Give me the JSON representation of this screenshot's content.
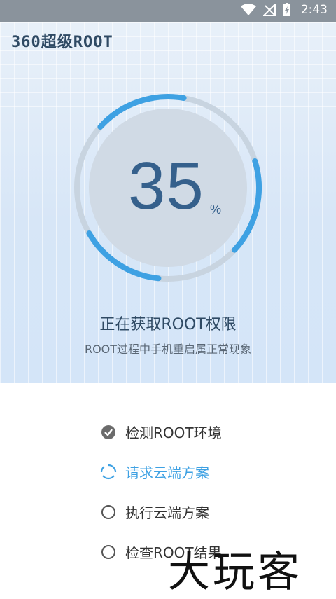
{
  "status_bar": {
    "time": "2:43"
  },
  "app": {
    "brand": "360超级ROOT"
  },
  "progress": {
    "percent": "35",
    "percent_sign": "%",
    "fraction": 0.35
  },
  "status": {
    "title": "正在获取ROOT权限",
    "subtitle": "ROOT过程中手机重启属正常现象"
  },
  "steps": [
    {
      "label": "检测ROOT环境",
      "state": "done"
    },
    {
      "label": "请求云端方案",
      "state": "in-progress"
    },
    {
      "label": "执行云端方案",
      "state": "pending"
    },
    {
      "label": "检查ROOT结果",
      "state": "pending"
    }
  ],
  "watermark": "大玩客",
  "colors": {
    "accent": "#3ea1e3",
    "text_dark": "#2f4a64",
    "number": "#35608c"
  }
}
